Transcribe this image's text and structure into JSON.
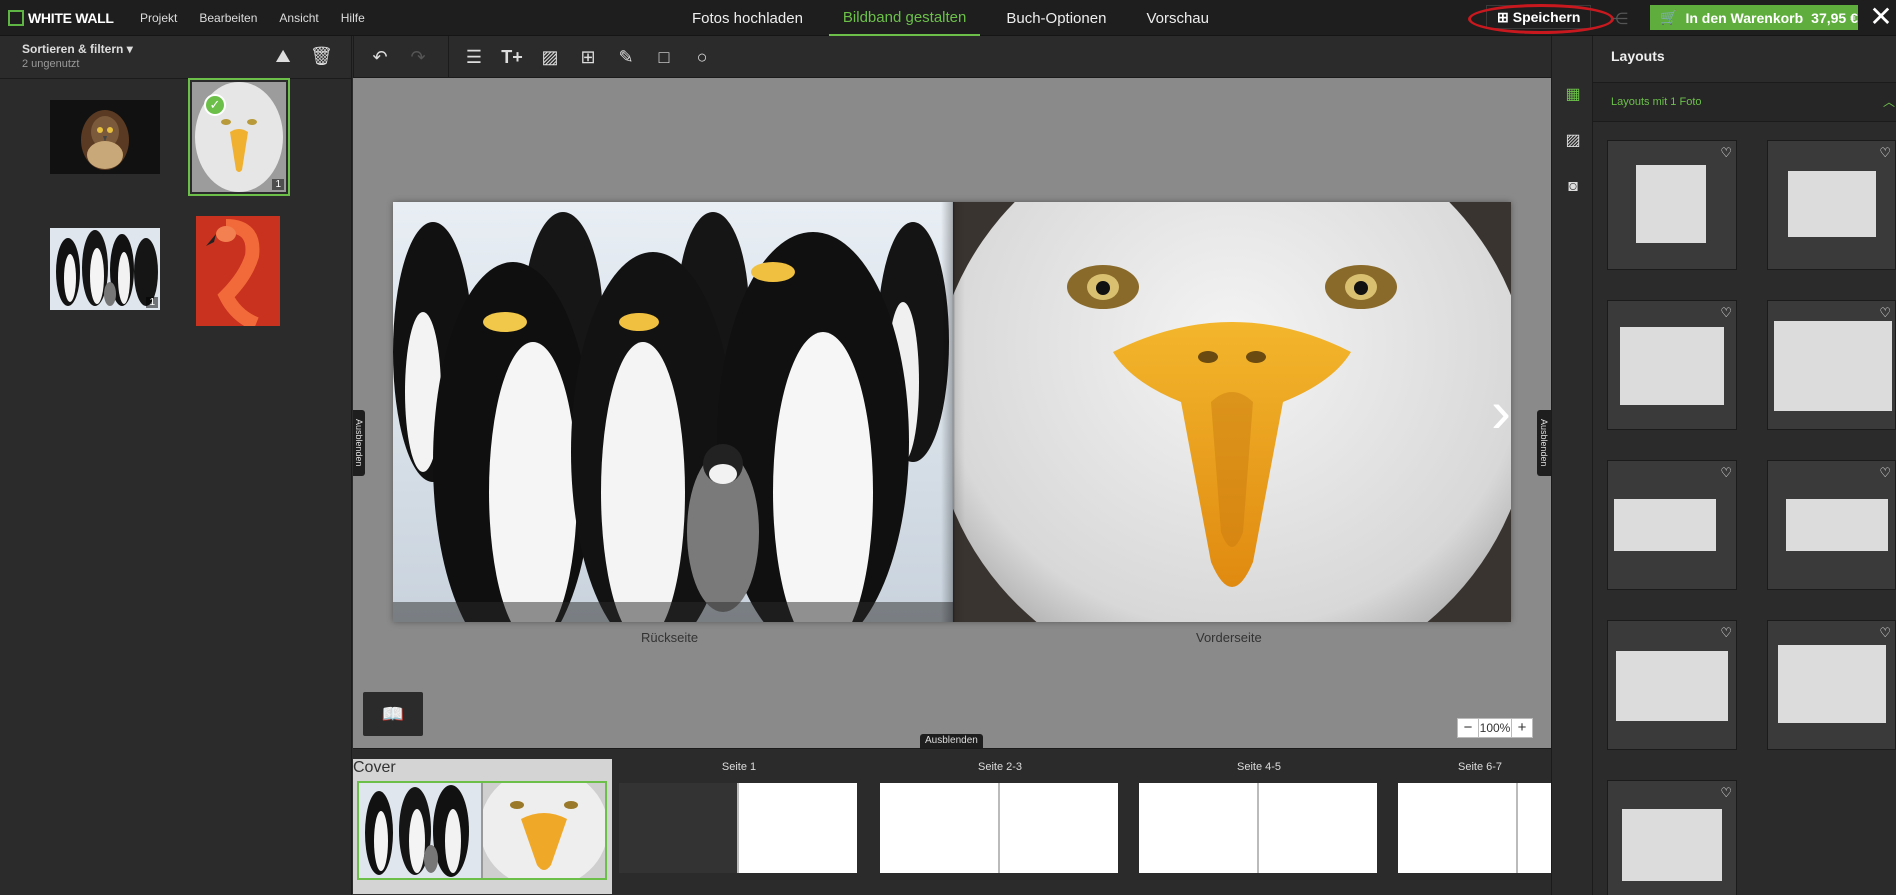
{
  "app": {
    "logo_text": "WHITE WALL"
  },
  "menu": [
    "Projekt",
    "Bearbeiten",
    "Ansicht",
    "Hilfe"
  ],
  "steps": [
    {
      "label": "Fotos hochladen",
      "active": false
    },
    {
      "label": "Bildband gestalten",
      "active": true
    },
    {
      "label": "Buch-Optionen",
      "active": false
    },
    {
      "label": "Vorschau",
      "active": false
    }
  ],
  "actions": {
    "save_label": "Speichern",
    "cart_label": "In den Warenkorb",
    "cart_price": "37,95 €",
    "close_icon": "close-icon"
  },
  "left_panel": {
    "filter_title": "Sortieren & filtern",
    "filter_sub": "2 ungenutzt",
    "photos": [
      {
        "name": "hawk",
        "count": ""
      },
      {
        "name": "eagle",
        "count": "1",
        "selected": true
      },
      {
        "name": "penguins",
        "count": "1"
      },
      {
        "name": "flamingo",
        "count": ""
      }
    ]
  },
  "canvas": {
    "page_left_label": "Rückseite",
    "page_right_label": "Vorderseite",
    "hide_left": "Ausblenden",
    "hide_right": "Ausblenden",
    "hide_bottom": "Ausblenden",
    "zoom_value": "100%"
  },
  "filmstrip": {
    "items": [
      "Cover",
      "Seite 1",
      "Seite 2-3",
      "Seite 4-5",
      "Seite 6-7"
    ]
  },
  "right_panel": {
    "title": "Layouts",
    "section_title": "Layouts mit 1 Foto"
  },
  "colors": {
    "accent": "#6cc04a",
    "cart": "#5fad3d",
    "save_highlight": "#c9191f",
    "canvas_bg": "#8a8a8a"
  }
}
